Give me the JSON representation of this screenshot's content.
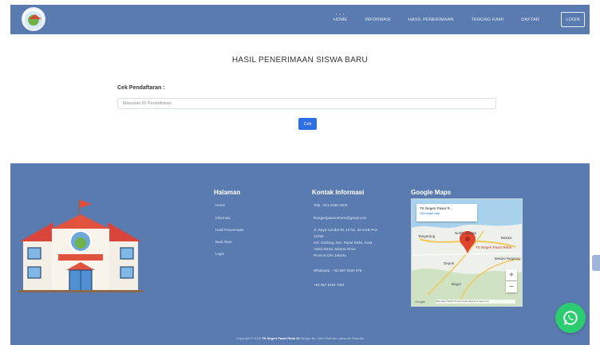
{
  "nav": {
    "links": [
      {
        "label": "HOME"
      },
      {
        "label": "INFORMASI"
      },
      {
        "label": "HASIL PENERIMAAN"
      },
      {
        "label": "TENGNG KAMI"
      },
      {
        "label": "DAFTAR"
      }
    ],
    "login_label": "LOGIN"
  },
  "main": {
    "title": "HASIL PENERIMAAN SISWA BARU",
    "cek_label": "Cek Pendaftaran :",
    "input_placeholder": "Masukan ID Pendaftaran",
    "button_label": "Cek"
  },
  "footer": {
    "halaman": {
      "title": "Halaman",
      "items": [
        "Home",
        "Informasi",
        "Hasil Penerimaan",
        "Buat Akun",
        "Login"
      ]
    },
    "kontak": {
      "title": "Kontak Informasi",
      "lines": [
        "Telp : 021-2290 2503",
        "tknegeripasarrebo01@gmail.com",
        "Jl. Raya Condet RL 12 No. 33 Kodk Pos",
        "13760",
        "Kel. Gedong, Kec. Pasar Rebo, Kota",
        "Administrasi Jakarta Timur",
        "Provinsi DKI Jakarta",
        "Whatsapp : +62 857 8334 978",
        "+62 857 5294 7661"
      ]
    },
    "maps": {
      "title": "Google Maps",
      "card_title": "TK Negeri Pasar R...",
      "card_link": "View larger map",
      "labels": [
        "Tangerang",
        "North Jakarta",
        "Bekasi",
        "Depok",
        "Bekasi Regency",
        "Bogor",
        "TK Negeri Pasar Rebo"
      ],
      "zoom_in": "+",
      "zoom_out": "−",
      "google": "Google",
      "footer_text": "Map data ©2023  Terms of Use  Report a map error"
    },
    "copyright_prefix": "Copyright © 2023 ",
    "copyright_bold": "TK Negeri Pasar Rebo 01",
    "copyright_suffix": " Design By : Adro Rafi dan Jakaudin Ramdan"
  },
  "colors": {
    "nav_bg": "#5a7bb0",
    "button": "#2f6fe4",
    "whatsapp": "#2ecc71"
  }
}
